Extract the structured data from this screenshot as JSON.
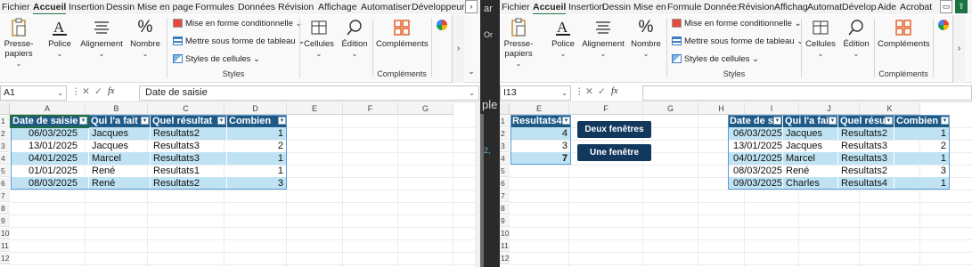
{
  "left": {
    "tabs": [
      "Fichier",
      "Accueil",
      "Insertion",
      "Dessin",
      "Mise en page",
      "Formules",
      "Données",
      "Révision",
      "Affichage",
      "Automatiser",
      "Développeur"
    ],
    "active_tab": "Accueil",
    "ribbon": {
      "paste": "Presse-papiers",
      "font": "Police",
      "alignment": "Alignement",
      "number": "Nombre",
      "cond_format": "Mise en forme conditionnelle",
      "format_table": "Mettre sous forme de tableau",
      "cell_styles": "Styles de cellules",
      "styles_group": "Styles",
      "cells": "Cellules",
      "edit": "Édition",
      "addins": "Compléments",
      "addins_group": "Compléments"
    },
    "namebox": "A1",
    "formula": "Date de saisie",
    "columns": [
      "A",
      "B",
      "C",
      "D",
      "E",
      "F",
      "G"
    ],
    "rows": [
      "1",
      "2",
      "3",
      "4",
      "5",
      "6",
      "7",
      "8",
      "9",
      "10",
      "11",
      "12"
    ],
    "table": {
      "headers": [
        "Date de saisie",
        "Qui l'a fait",
        "Quel résultat",
        "Combien"
      ],
      "rows": [
        [
          "06/03/2025",
          "Jacques",
          "Resultats2",
          "1"
        ],
        [
          "13/01/2025",
          "Jacques",
          "Resultats3",
          "2"
        ],
        [
          "04/01/2025",
          "Marcel",
          "Resultats3",
          "1"
        ],
        [
          "01/01/2025",
          "René",
          "Resultats1",
          "1"
        ],
        [
          "08/03/2025",
          "René",
          "Resultats2",
          "3"
        ]
      ]
    }
  },
  "right": {
    "tabs": [
      "Fichier",
      "Accueil",
      "Insertion",
      "Dessin",
      "Mise en",
      "Formule",
      "Donnée:",
      "Révision",
      "Affichag",
      "Automat",
      "Dévelop",
      "Aide",
      "Acrobat"
    ],
    "active_tab": "Accueil",
    "ribbon": {
      "paste": "Presse-papiers",
      "font": "Police",
      "alignment": "Alignement",
      "number": "Nombre",
      "cond_format": "Mise en forme conditionnelle",
      "format_table": "Mettre sous forme de tableau",
      "cell_styles": "Styles de cellules",
      "styles_group": "Styles",
      "cells": "Cellules",
      "edit": "Édition",
      "addins": "Compléments",
      "addins_group": "Compléments"
    },
    "namebox": "I13",
    "formula": "",
    "columns": [
      "E",
      "F",
      "G",
      "H",
      "I",
      "J",
      "K"
    ],
    "rows": [
      "1",
      "2",
      "3",
      "4",
      "5",
      "6",
      "7",
      "8",
      "9",
      "10",
      "11",
      "12"
    ],
    "summary": {
      "header": "Resultats4",
      "values": [
        "4",
        "3",
        "7"
      ]
    },
    "buttons": {
      "two_windows": "Deux fenêtres",
      "one_window": "Une fenêtre"
    },
    "table": {
      "headers": [
        "Date de s",
        "Qui l'a fai",
        "Quel résu",
        "Combien"
      ],
      "rows": [
        [
          "06/03/2025",
          "Jacques",
          "Resultats2",
          "1"
        ],
        [
          "13/01/2025",
          "Jacques",
          "Resultats3",
          "2"
        ],
        [
          "04/01/2025",
          "Marcel",
          "Resultats3",
          "1"
        ],
        [
          "08/03/2025",
          "René",
          "Resultats2",
          "3"
        ],
        [
          "09/03/2025",
          "Charles",
          "Resultats4",
          "1"
        ]
      ]
    }
  },
  "gap_texts": [
    "ar",
    "Or",
    "ple",
    "2,"
  ],
  "colors": {
    "header": "#1f5a87",
    "band": "#bfe3f2",
    "accent": "#1a7343",
    "button": "#12385e"
  }
}
